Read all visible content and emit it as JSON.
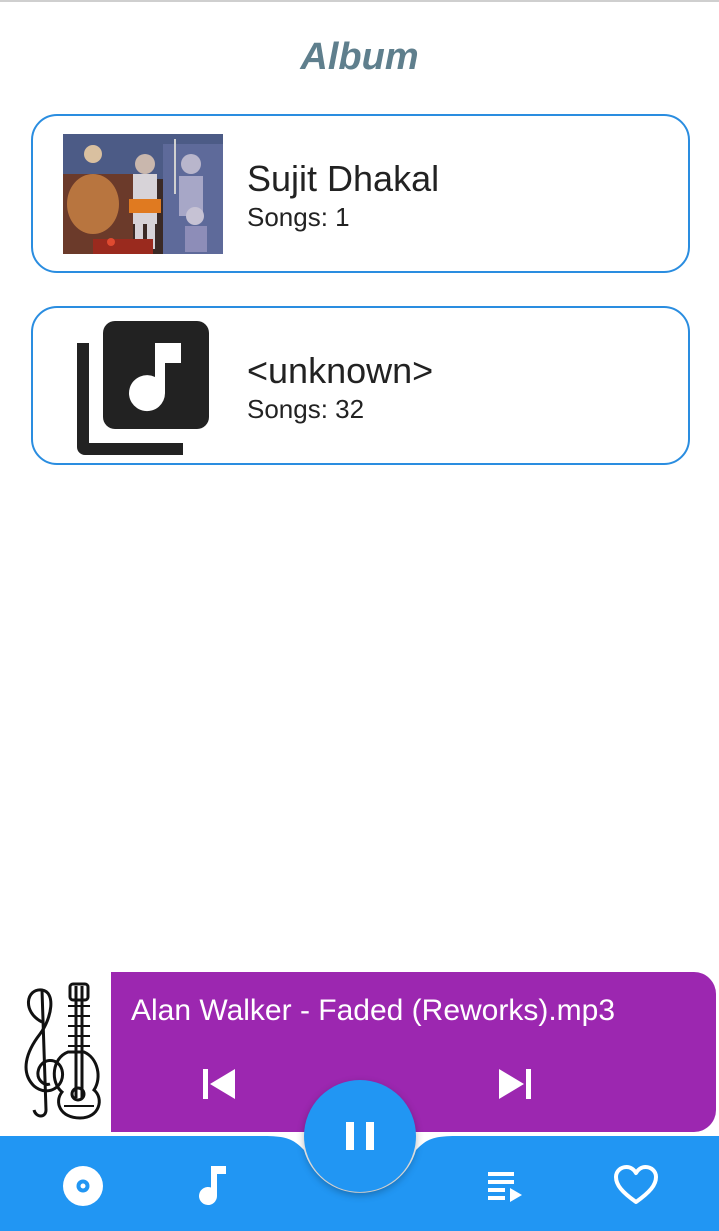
{
  "header": {
    "title": "Album"
  },
  "albums": [
    {
      "name": "Sujit Dhakal",
      "count": "Songs: 1",
      "art": "album-photo"
    },
    {
      "name": "<unknown>",
      "count": "Songs: 32",
      "art": "library-music-icon"
    }
  ],
  "player": {
    "track": "Alan Walker - Faded (Reworks).mp3",
    "thumb_icon": "guitar-treble-clef-icon",
    "prev_icon": "skip-previous-icon",
    "next_icon": "skip-next-icon",
    "play_state_icon": "pause-icon",
    "bar_color": "#9c27b0"
  },
  "bottom_nav": {
    "items": [
      "album-icon",
      "music-note-icon",
      "playlist-play-icon",
      "heart-icon"
    ],
    "color": "#2196f3"
  }
}
